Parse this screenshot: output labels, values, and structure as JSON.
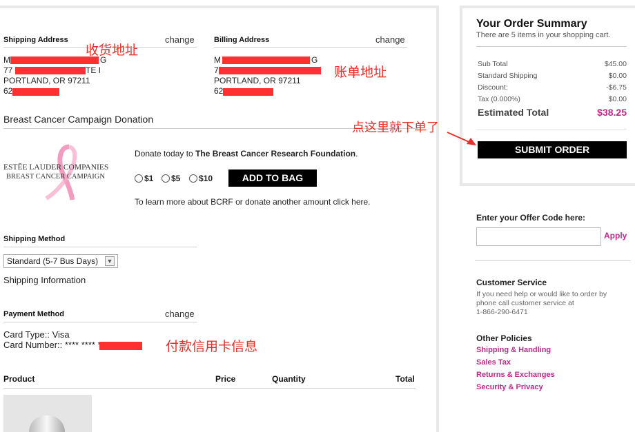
{
  "shipping_address": {
    "heading": "Shipping Address",
    "change": "change",
    "lines": [
      "M",
      "G",
      "77",
      "TE I",
      "PORTLAND, OR 97211",
      "62"
    ]
  },
  "billing_address": {
    "heading": "Billing Address",
    "change": "change",
    "lines": [
      "M",
      "G",
      "7",
      "PORTLAND, OR 97211",
      "62"
    ]
  },
  "annotations": {
    "shipping": "收货地址",
    "billing": "账单地址",
    "submit": "点这里就下单了",
    "payment": "付款信用卡信息"
  },
  "donation": {
    "heading": "Breast Cancer Campaign Donation",
    "logo_line1": "ESTĒE LAUDER COMPANIES",
    "logo_line2": "BREAST CANCER CAMPAIGN",
    "text_prefix": "Donate today to ",
    "text_bold": "The Breast Cancer Research Foundation",
    "text_suffix": ".",
    "options": [
      "$1",
      "$5",
      "$10"
    ],
    "add_to_bag": "ADD TO BAG",
    "learn_more": "To learn more about BCRF or donate another amount click here."
  },
  "shipping_method": {
    "heading": "Shipping Method",
    "selected": "Standard (5-7 Bus Days)",
    "info_link": "Shipping Information"
  },
  "payment_method": {
    "heading": "Payment Method",
    "change": "change",
    "card_type": "Card Type:: Visa",
    "card_number": "Card Number:: **** **** *"
  },
  "product_table": {
    "columns": [
      "Product",
      "Price",
      "Quantity",
      "Total"
    ]
  },
  "order_summary": {
    "title": "Your Order Summary",
    "subtitle": "There are 5 items in your shopping cart.",
    "rows": [
      {
        "label": "Sub Total",
        "value": "$45.00"
      },
      {
        "label": "Standard Shipping",
        "value": "$0.00"
      },
      {
        "label": "Discount:",
        "value": "-$6.75"
      },
      {
        "label": "Tax (0.000%)",
        "value": "$0.00"
      }
    ],
    "estimated_label": "Estimated Total",
    "estimated_value": "$38.25",
    "submit": "SUBMIT ORDER"
  },
  "offer": {
    "label": "Enter your Offer Code here:",
    "placeholder": "",
    "apply": "Apply"
  },
  "customer_service": {
    "heading": "Customer Service",
    "text1": "If you need help or would like to order by",
    "text2": "phone call customer service at",
    "phone": "1-866-290-6471"
  },
  "policies": {
    "heading": "Other Policies",
    "links": [
      "Shipping & Handling",
      "Sales Tax",
      "Returns & Exchanges",
      "Security & Privacy"
    ]
  },
  "colors": {
    "accent_pink": "#c0288a",
    "annotation_red": "#e8302a",
    "redaction": "#ff3030"
  }
}
